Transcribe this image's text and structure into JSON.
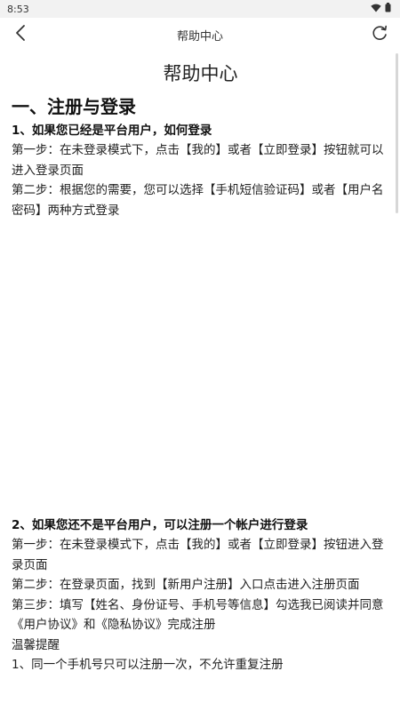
{
  "status_bar": {
    "time": "8:53"
  },
  "app_bar": {
    "title": "帮助中心"
  },
  "icons": {
    "back": "chevron-left-icon",
    "refresh": "refresh-icon",
    "wifi": "wifi-icon",
    "battery": "battery-icon"
  },
  "document": {
    "title": "帮助中心",
    "section1": {
      "heading": "一、注册与登录",
      "q1": {
        "title": "1、如果您已经是平台用户，如何登录",
        "lines": [
          "第一步：在未登录模式下，点击【我的】或者【立即登录】按钮就可以进入登录页面",
          "第二步：根据您的需要，您可以选择【手机短信验证码】或者【用户名密码】两种方式登录"
        ]
      },
      "q2": {
        "title": "2、如果您还不是平台用户，可以注册一个帐户进行登录",
        "lines": [
          "第一步：在未登录模式下，点击【我的】或者【立即登录】按钮进入登录页面",
          "第二步：在登录页面，找到【新用户注册】入口点击进入注册页面",
          "第三步：填写【姓名、身份证号、手机号等信息】勾选我已阅读并同意《用户协议》和《隐私协议》完成注册",
          "温馨提醒",
          "1、同一个手机号只可以注册一次，不允许重复注册"
        ]
      }
    }
  }
}
